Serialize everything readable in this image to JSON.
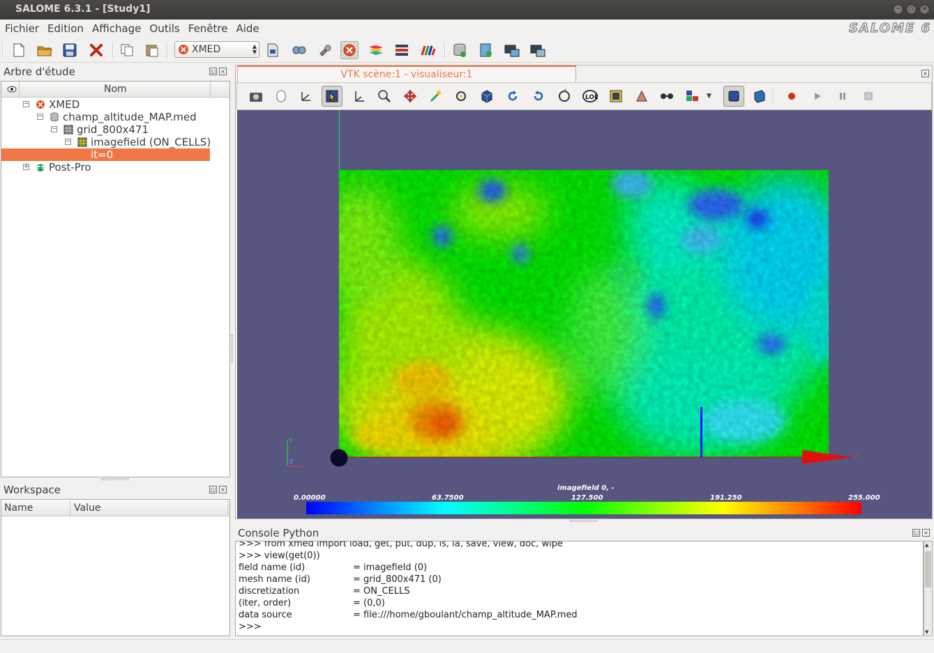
{
  "window": {
    "title": "SALOME 6.3.1 - [Study1]",
    "brand": "SALOME 6",
    "controls": [
      "minimize",
      "maximize",
      "close"
    ]
  },
  "menubar": {
    "items": [
      "Fichier",
      "Edition",
      "Affichage",
      "Outils",
      "Fenêtre",
      "Aide"
    ]
  },
  "toolbar": {
    "module_select_value": "XMED",
    "icons": [
      "new-document-icon",
      "open-folder-icon",
      "save-icon",
      "close-document-icon",
      "copy-icon",
      "paste-icon",
      "module-selector",
      "load-module-icon",
      "dump-study-icon",
      "gear-icon",
      "xmed-module-icon",
      "post-pro-icon",
      "mesh-icon",
      "colormap-icon",
      "database-icon",
      "add-field-icon",
      "workspace-save-icon",
      "workspace-load-icon"
    ]
  },
  "study_tree": {
    "title": "Arbre d'étude",
    "column_header": "Nom",
    "nodes": [
      {
        "label": "XMED",
        "level": 0,
        "icon": "xmed-icon",
        "expander": "−"
      },
      {
        "label": "champ_altitude_MAP.med",
        "level": 1,
        "icon": "database-icon",
        "expander": "−"
      },
      {
        "label": "grid_800x471",
        "level": 2,
        "icon": "grid-icon",
        "expander": "−"
      },
      {
        "label": "imagefield (ON_CELLS)",
        "level": 3,
        "icon": "field-icon",
        "expander": "−"
      },
      {
        "label": "it=0",
        "level": 4,
        "icon": "",
        "selected": true
      },
      {
        "label": "Post-Pro",
        "level": 0,
        "icon": "postpro-icon",
        "expander": "+"
      }
    ]
  },
  "workspace": {
    "title": "Workspace",
    "columns": [
      "Name",
      "Value"
    ]
  },
  "viewer": {
    "tab_label": "VTK scène:1 - visualiseur:1",
    "field_title": "imagefield 0, -",
    "colorbar_labels": [
      "0.00000",
      "63.7500",
      "127.500",
      "191.250",
      "255.000"
    ],
    "axis_labels": {
      "x": "X",
      "y": "Y",
      "z": "Z"
    },
    "colors": {
      "background": "#565681",
      "accent": "#f07746"
    }
  },
  "console": {
    "title": "Console Python",
    "lines": [
      {
        "key": ">>> from xmed import load, get, put, dup, ls, la, save, view, doc, wipe",
        "value": ""
      },
      {
        "key": ">>> view(get(0))",
        "value": ""
      },
      {
        "key": "field name (id)",
        "value": "= imagefield (0)"
      },
      {
        "key": "mesh name (id)",
        "value": "= grid_800x471 (0)"
      },
      {
        "key": "discretization",
        "value": "= ON_CELLS"
      },
      {
        "key": "(iter, order)",
        "value": "= (0,0)"
      },
      {
        "key": "data source",
        "value": "= file:///home/gboulant/champ_altitude_MAP.med"
      },
      {
        "key": ">>>",
        "value": ""
      }
    ]
  }
}
